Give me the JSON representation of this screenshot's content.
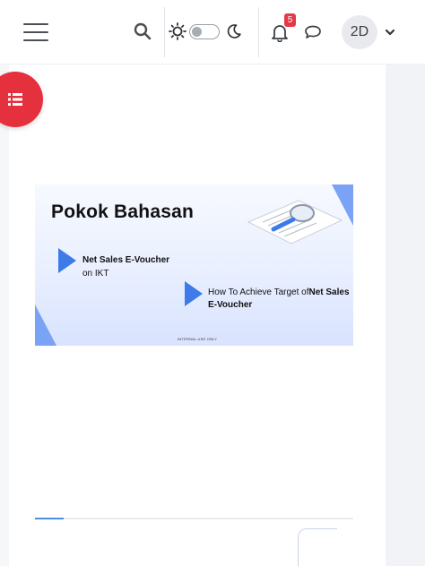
{
  "header": {
    "menu_icon": "hamburger-icon",
    "search_icon": "search-icon",
    "theme": {
      "light_icon": "sun-icon",
      "dark_icon": "moon-icon",
      "toggle_state": "light"
    },
    "notifications": {
      "icon": "bell-icon",
      "count": "5"
    },
    "messages_icon": "chat-icon",
    "user": {
      "initials": "2D",
      "caret_icon": "chevron-down-icon"
    }
  },
  "toc_button": {
    "icon": "list-icon",
    "color": "#e5303d"
  },
  "slide": {
    "title": "Pokok Bahasan",
    "bullet1_bold": "Net Sales E-Voucher",
    "bullet1_rest": "on IKT",
    "bullet2_prefix": "How To Achieve Target of",
    "bullet2_bold": "Net Sales E-Voucher",
    "footer": "INTERNAL USE ONLY",
    "accent_color": "#3f7be8"
  },
  "progress": {
    "value": 0.09,
    "color": "#4a90e2"
  }
}
